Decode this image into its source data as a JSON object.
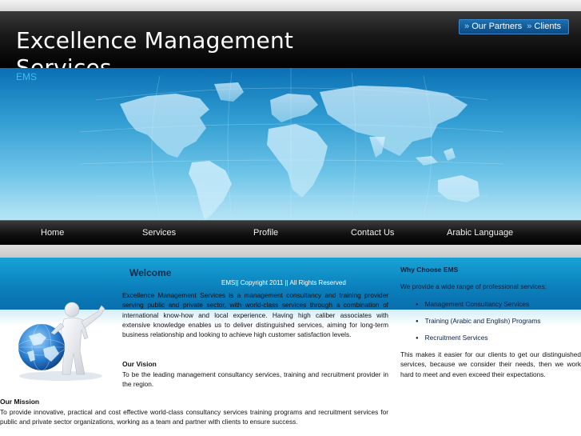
{
  "header": {
    "title": "Excellence Management Services",
    "tagline": "EMS",
    "top_links": [
      "Our Partners",
      "Clients"
    ],
    "link_separator": "»"
  },
  "nav": {
    "items": [
      "Home",
      "Services",
      "Profile",
      "Contact Us",
      "Arabic Language"
    ]
  },
  "main": {
    "welcome_heading": "Welcome",
    "copyright": "EMS|| Copyright 2011 || All Rights Reserved",
    "intro": "Excellence Management Services is a management consultancy and training provider serving public and private sector, with world-class services through a combination of international know-how and local experience. Having high caliber associates with extensive knowledge enables us to deliver distinguished services, aiming for long-term business relationship and looking to achieve high customer satisfaction levels.",
    "vision_heading": "Our Vision",
    "vision": "To be the leading management consultancy services, training and recruitment provider in the region.",
    "mission_heading": "Our Mission",
    "mission": "To provide innovative, practical and cost effective world-class consultancy services training programs and recruitment services for public and private sector organizations, working as a team and partner with clients to ensure success."
  },
  "sidebar": {
    "heading": "Why Choose EMS",
    "intro": "We provide a wide range of professional services:",
    "services": [
      "Management Consultancy Services",
      "Training (Arabic and English) Programs",
      "Recruitment Services"
    ],
    "closing": "This makes it easier for our clients to get our distinguished services, because we consider their needs, then we work hard to meet and even exceed their expectations."
  },
  "colors": {
    "header_bg": "#000000",
    "banner_blue": "#1590cc",
    "content_band": "#0b7fbb",
    "link_box": "#1b6fb1"
  },
  "icons": {
    "figure": "person-holding-globe-icon",
    "banner": "world-map-icon"
  }
}
